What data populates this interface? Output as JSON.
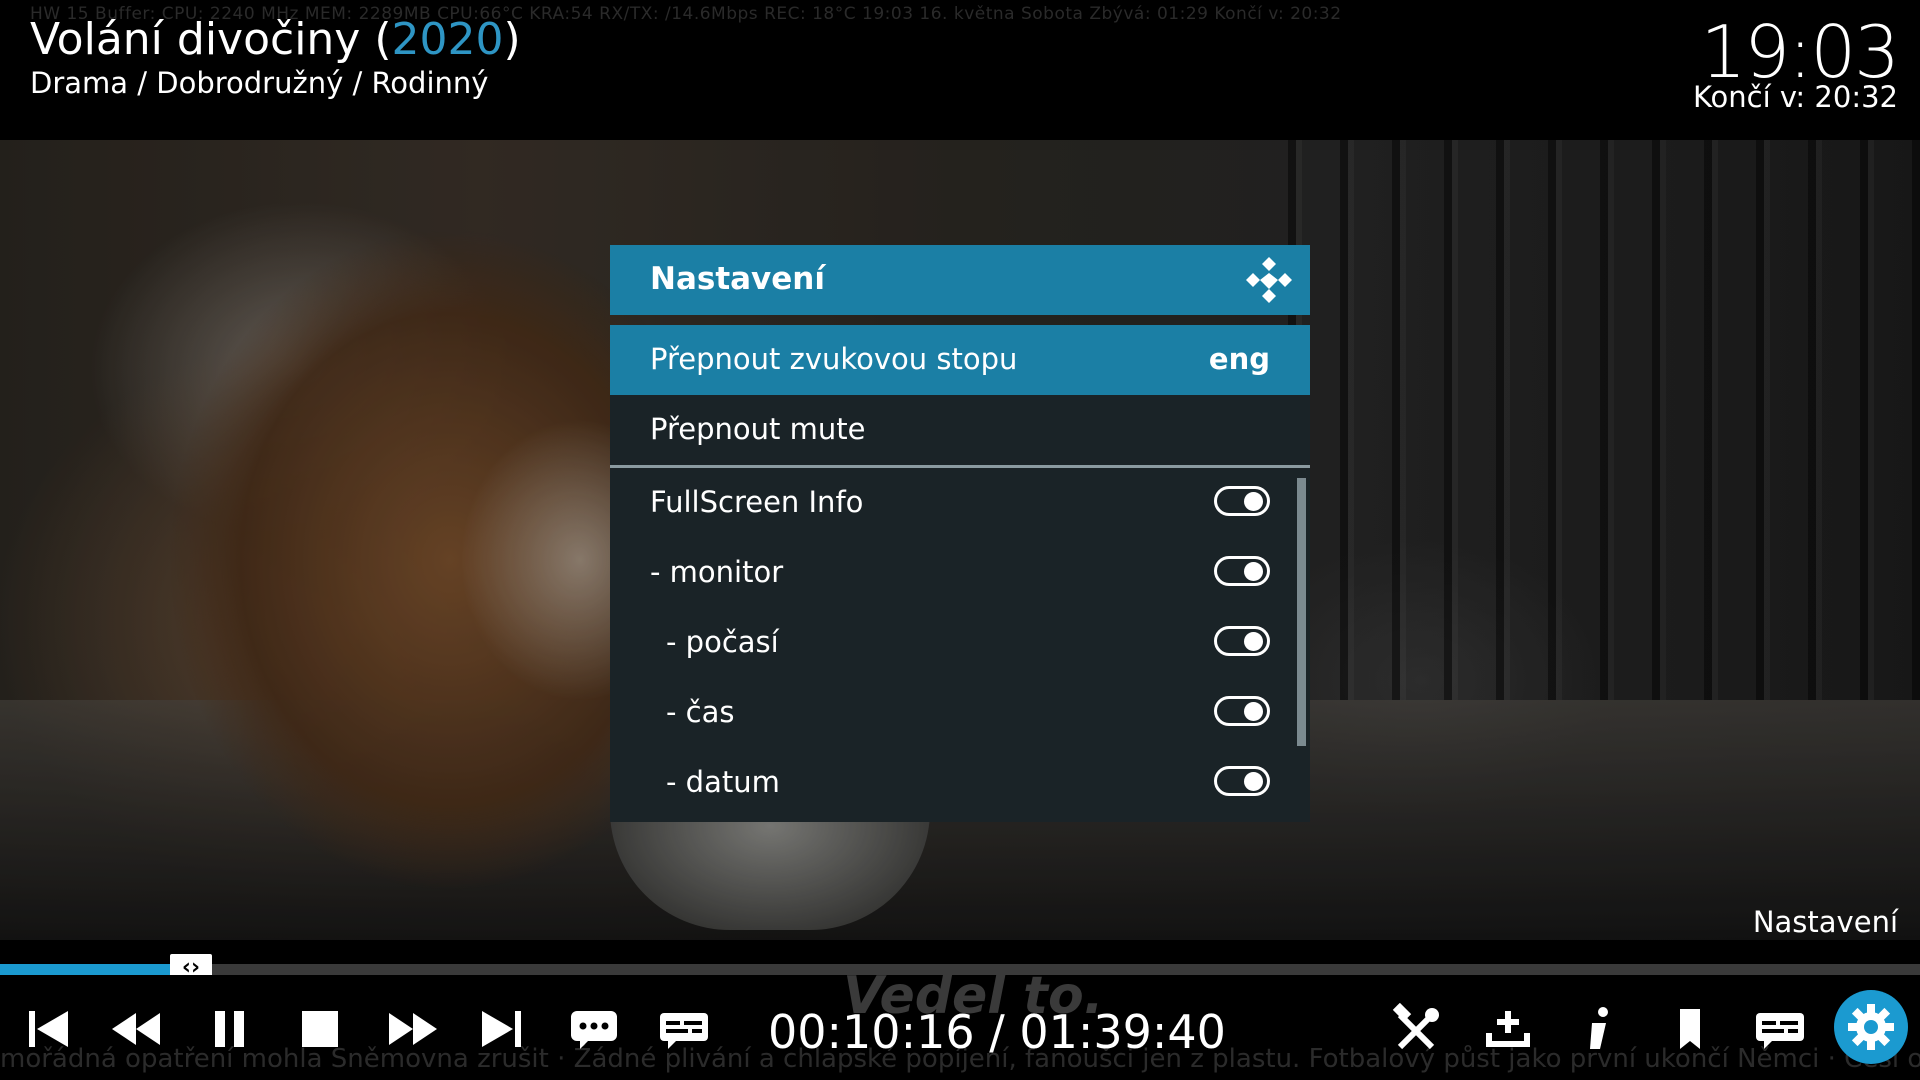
{
  "header": {
    "stats_line": "HW  15  Buffer:        CPU:        2240 MHz  MEM:          2289MB  CPU:66°C  KRA:54  RX/TX:        /14.6Mbps          REC:                                 18°C        19:03  16. května Sobota   Zbývá: 01:29   Končí v: 20:32",
    "title": "Volání divočiny (",
    "year": "2020",
    "title_close": ")",
    "genre": "Drama / Dobrodružný / Rodinný",
    "clock": "19:03",
    "end_time": "Končí v: 20:32"
  },
  "dialog": {
    "title": "Nastavení",
    "items": [
      {
        "label": "Přepnout zvukovou stopu",
        "value": "eng"
      },
      {
        "label": "Přepnout mute",
        "value": ""
      },
      {
        "label": "FullScreen Info",
        "toggle": true
      },
      {
        "label": "- monitor",
        "toggle": true
      },
      {
        "label": "- počasí",
        "toggle": true
      },
      {
        "label": "- čas",
        "toggle": true
      },
      {
        "label": "- datum",
        "toggle": true
      }
    ]
  },
  "osd": {
    "label": "Nastavení",
    "progress": 0.102,
    "time": "00:10:16 / 01:39:40",
    "subtitle": "Vedel to.",
    "ticker": "mořádná opatření mohla Sněmovna zrušit · Žádné plivání a chlapské popíjení, fanoušci jen z plastu. Fotbalový půst jako první ukončí Němci · Češi ocenují, že n"
  },
  "colors": {
    "accent": "#1b7fa5",
    "year": "#2e95c4",
    "dialog_bg": "#1a2327"
  }
}
